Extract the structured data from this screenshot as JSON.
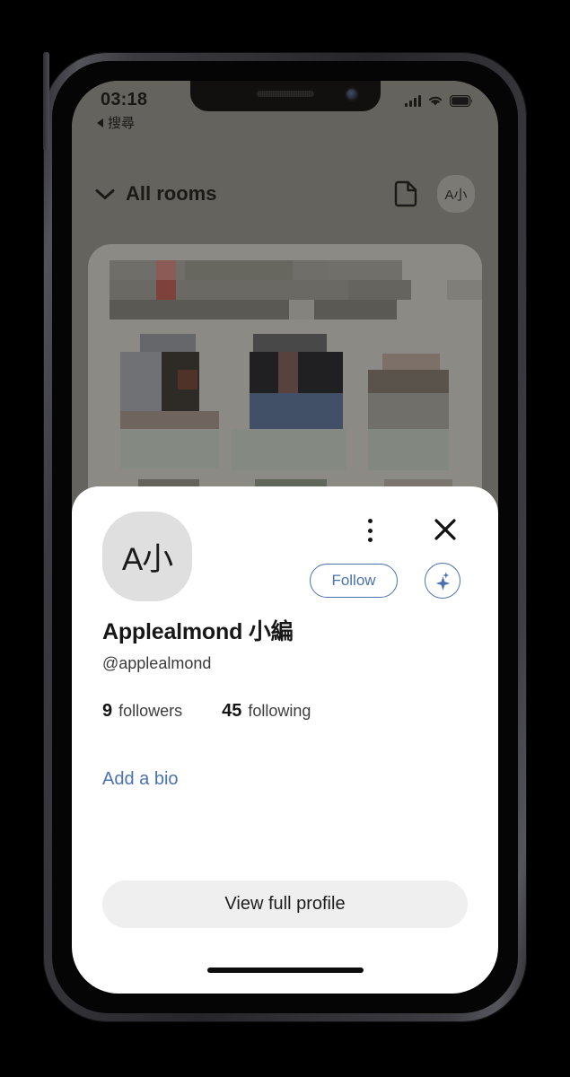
{
  "status_bar": {
    "time": "03:18",
    "signal_icon": "cellular-signal-icon",
    "wifi_icon": "wifi-icon",
    "battery_icon": "battery-icon"
  },
  "back_nav": {
    "label": "搜尋",
    "icon": "back-arrow-icon"
  },
  "app_header": {
    "rooms_label": "All rooms",
    "chevron_icon": "chevron-down-icon",
    "document_icon": "document-icon",
    "avatar_initials": "A小"
  },
  "profile_sheet": {
    "avatar_initials": "A小",
    "more_options_icon": "more-vertical-icon",
    "close_icon": "close-icon",
    "follow_label": "Follow",
    "ai_sparkle_icon": "sparkle-icon",
    "name": "Applealmond 小編",
    "handle": "@applealmond",
    "stats": [
      {
        "count": "9",
        "label": "followers"
      },
      {
        "count": "45",
        "label": "following"
      }
    ],
    "add_bio_label": "Add a bio",
    "view_full_profile_label": "View full profile"
  },
  "colors": {
    "accent_blue": "#4a72ae",
    "sheet_background": "#ffffff",
    "button_background": "#efefef",
    "avatar_background": "#dfdfdf",
    "app_background": "#7b7b76"
  }
}
